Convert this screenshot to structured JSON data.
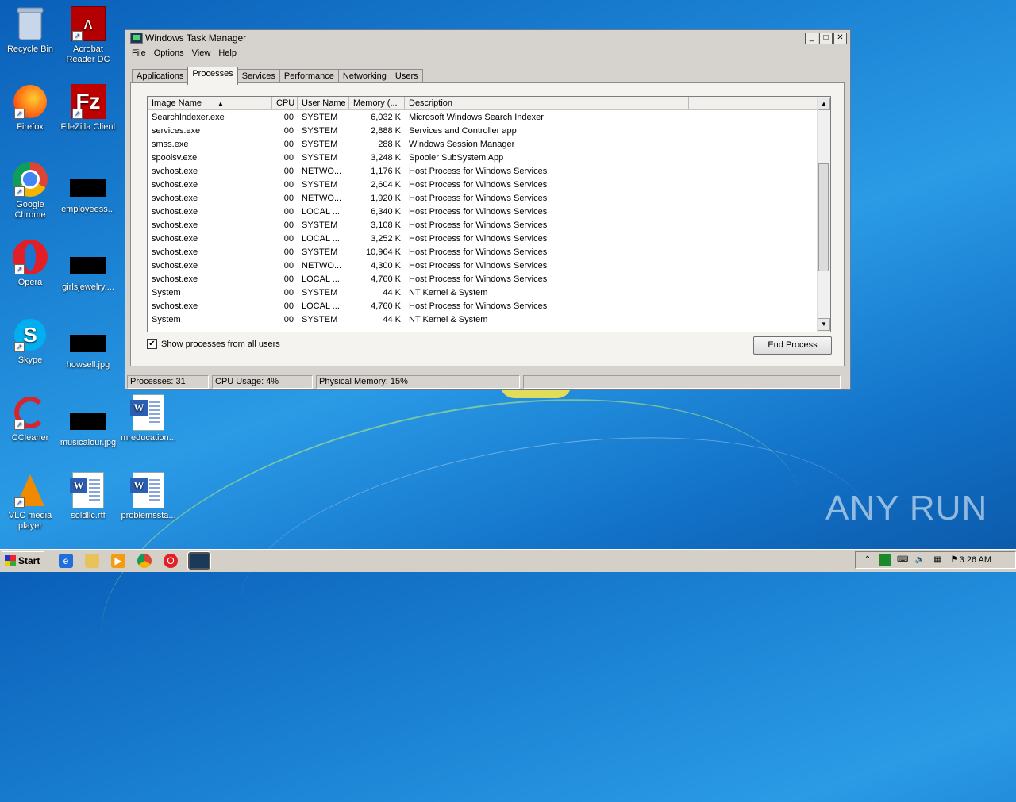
{
  "desktop": {
    "icons": [
      {
        "label": "Recycle Bin"
      },
      {
        "label": "Acrobat Reader DC"
      },
      {
        "label": "Firefox"
      },
      {
        "label": "FileZilla Client"
      },
      {
        "label": "Google Chrome"
      },
      {
        "label": "employeess..."
      },
      {
        "label": "Opera"
      },
      {
        "label": "girlsjewelry...."
      },
      {
        "label": "Skype"
      },
      {
        "label": "howsell.jpg"
      },
      {
        "label": "CCleaner"
      },
      {
        "label": "musicalour.jpg"
      },
      {
        "label": "mreducation..."
      },
      {
        "label": "VLC media player"
      },
      {
        "label": "soldllc.rtf"
      },
      {
        "label": "problemssta..."
      }
    ]
  },
  "window": {
    "title": "Windows Task Manager",
    "buttons": {
      "minimize": "_",
      "maximize": "□",
      "close": "✕"
    },
    "menu": [
      "File",
      "Options",
      "View",
      "Help"
    ],
    "tabs": [
      "Applications",
      "Processes",
      "Services",
      "Performance",
      "Networking",
      "Users"
    ],
    "active_tab": "Processes",
    "columns": [
      "Image Name",
      "CPU",
      "User Name",
      "Memory (...",
      "Description"
    ],
    "processes": [
      {
        "name": "SearchIndexer.exe",
        "cpu": "00",
        "user": "SYSTEM",
        "mem": "6,032 K",
        "desc": "Microsoft Windows Search Indexer"
      },
      {
        "name": "services.exe",
        "cpu": "00",
        "user": "SYSTEM",
        "mem": "2,888 K",
        "desc": "Services and Controller app"
      },
      {
        "name": "smss.exe",
        "cpu": "00",
        "user": "SYSTEM",
        "mem": "288 K",
        "desc": "Windows Session Manager"
      },
      {
        "name": "spoolsv.exe",
        "cpu": "00",
        "user": "SYSTEM",
        "mem": "3,248 K",
        "desc": "Spooler SubSystem App"
      },
      {
        "name": "svchost.exe",
        "cpu": "00",
        "user": "NETWO...",
        "mem": "1,176 K",
        "desc": "Host Process for Windows Services"
      },
      {
        "name": "svchost.exe",
        "cpu": "00",
        "user": "SYSTEM",
        "mem": "2,604 K",
        "desc": "Host Process for Windows Services"
      },
      {
        "name": "svchost.exe",
        "cpu": "00",
        "user": "NETWO...",
        "mem": "1,920 K",
        "desc": "Host Process for Windows Services"
      },
      {
        "name": "svchost.exe",
        "cpu": "00",
        "user": "LOCAL ...",
        "mem": "6,340 K",
        "desc": "Host Process for Windows Services"
      },
      {
        "name": "svchost.exe",
        "cpu": "00",
        "user": "SYSTEM",
        "mem": "3,108 K",
        "desc": "Host Process for Windows Services"
      },
      {
        "name": "svchost.exe",
        "cpu": "00",
        "user": "LOCAL ...",
        "mem": "3,252 K",
        "desc": "Host Process for Windows Services"
      },
      {
        "name": "svchost.exe",
        "cpu": "00",
        "user": "SYSTEM",
        "mem": "10,964 K",
        "desc": "Host Process for Windows Services"
      },
      {
        "name": "svchost.exe",
        "cpu": "00",
        "user": "NETWO...",
        "mem": "4,300 K",
        "desc": "Host Process for Windows Services"
      },
      {
        "name": "svchost.exe",
        "cpu": "00",
        "user": "LOCAL ...",
        "mem": "4,760 K",
        "desc": "Host Process for Windows Services"
      },
      {
        "name": "System",
        "cpu": "00",
        "user": "SYSTEM",
        "mem": "44 K",
        "desc": "NT Kernel & System"
      },
      {
        "name": "svchost.exe",
        "cpu": "00",
        "user": "LOCAL ...",
        "mem": "4,760 K",
        "desc": "Host Process for Windows Services"
      },
      {
        "name": "System",
        "cpu": "00",
        "user": "SYSTEM",
        "mem": "44 K",
        "desc": "NT Kernel & System"
      }
    ],
    "show_all_label": "Show processes from all users",
    "end_process_label": "End Process",
    "status": {
      "processes": "Processes: 31",
      "cpu": "CPU Usage: 4%",
      "memory": "Physical Memory: 15%"
    }
  },
  "taskbar": {
    "start_label": "Start",
    "clock": "3:26 AM"
  },
  "watermark": "ANY RUN"
}
